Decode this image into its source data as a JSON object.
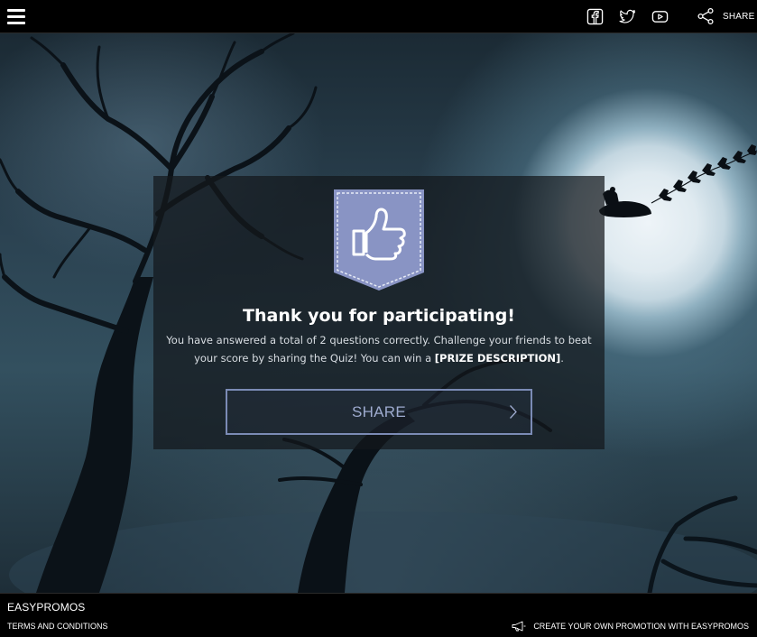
{
  "header": {
    "share_label": "SHARE"
  },
  "icons": {
    "menu": "hamburger-icon",
    "facebook": "facebook-icon",
    "twitter": "twitter-icon",
    "youtube": "youtube-icon",
    "share": "share-icon",
    "thumbs_up": "thumbs-up-icon",
    "chevron": "chevron-right-icon",
    "megaphone": "megaphone-icon"
  },
  "card": {
    "title": "Thank you for participating!",
    "description_line1": "You have answered a total of 2 questions correctly. Challenge your friends to beat",
    "description_line2_prefix": "your score by sharing the Quiz! You can win a ",
    "description_prize": "[PRIZE DESCRIPTION]",
    "description_suffix": ".",
    "share_button_label": "SHARE"
  },
  "footer": {
    "brand": "EASYPROMOS",
    "terms_label": "TERMS AND CONDITIONS",
    "create_label": "CREATE YOUR OWN PROMOTION WITH EASYPROMOS"
  },
  "colors": {
    "badge": "#8994c4",
    "button_border": "#7b8bb5",
    "button_text": "#9eabcf",
    "card_bg": "rgba(20,24,28,0.72)"
  }
}
